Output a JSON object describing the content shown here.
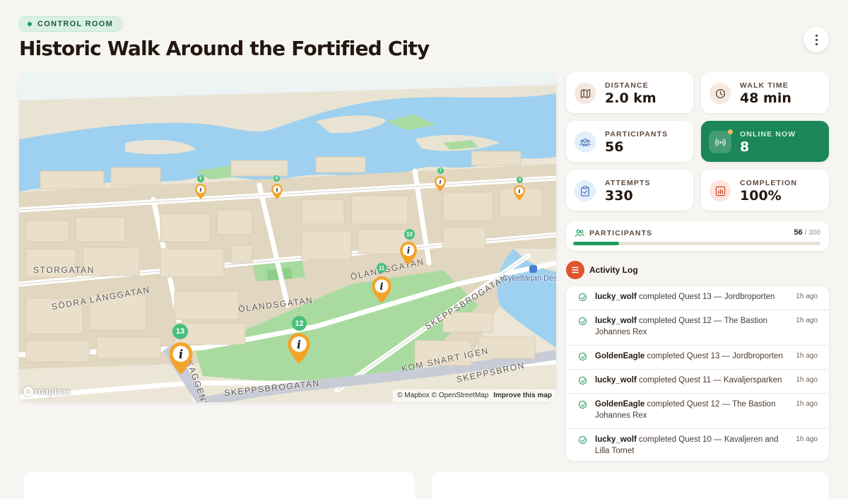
{
  "header": {
    "badge": "CONTROL ROOM",
    "title": "Historic Walk Around the Fortified City",
    "more_icon": "more-vertical-icon"
  },
  "map": {
    "street_labels": [
      "STORGATAN",
      "SÖDRA LÅNGGATAN",
      "ÖLANDSGATAN",
      "ÖLANDSGATAN",
      "SKEPPSBROGATAN",
      "KOM SNART IGEN",
      "SKEPPSBRON",
      "KAGGENSG",
      "SKEPPSBROGATAN"
    ],
    "poi_label": "Cykelfärjan Des",
    "pins": [
      {
        "num": "6"
      },
      {
        "num": "8"
      },
      {
        "num": "7"
      },
      {
        "num": "4"
      },
      {
        "num": "10"
      },
      {
        "num": "11"
      },
      {
        "num": "12"
      },
      {
        "num": "13"
      }
    ],
    "logo": "mapbox",
    "attribution": "© Mapbox © OpenStreetMap",
    "improve": "Improve this map",
    "colors": {
      "water": "#9ed1ef",
      "park": "#a9dba0",
      "building": "#e4d9c3",
      "pin": "#f4a32a",
      "badge": "#47c07c"
    }
  },
  "stats": [
    {
      "label": "DISTANCE",
      "value": "2.0 km",
      "icon": "map-icon",
      "color": "#f4e8df"
    },
    {
      "label": "WALK TIME",
      "value": "48 min",
      "icon": "clock-icon",
      "color": "#f4e8df"
    },
    {
      "label": "PARTICIPANTS",
      "value": "56",
      "icon": "users-icon",
      "color": "#e2eefb"
    },
    {
      "label": "ONLINE NOW",
      "value": "8",
      "icon": "broadcast-icon",
      "color": "#1b8658"
    },
    {
      "label": "ATTEMPTS",
      "value": "330",
      "icon": "clipboard-check-icon",
      "color": "#e2eefb"
    },
    {
      "label": "COMPLETION",
      "value": "100%",
      "icon": "bar-chart-icon",
      "color": "#fde4dc"
    }
  ],
  "participants_progress": {
    "label": "PARTICIPANTS",
    "count": "56",
    "total": "/ 300",
    "fraction": 0.187
  },
  "activity_log": {
    "title": "Activity Log",
    "items": [
      {
        "user": "lucky_wolf",
        "text": "completed Quest 13 — Jordbroporten",
        "time": "1h ago"
      },
      {
        "user": "lucky_wolf",
        "text": "completed Quest 12 — The Bastion Johannes Rex",
        "time": "1h ago"
      },
      {
        "user": "GoldenEagle",
        "text": "completed Quest 13 — Jordbroporten",
        "time": "1h ago"
      },
      {
        "user": "lucky_wolf",
        "text": "completed Quest 11 — Kavaljersparken",
        "time": "1h ago"
      },
      {
        "user": "GoldenEagle",
        "text": "completed Quest 12 — The Bastion Johannes Rex",
        "time": "1h ago"
      },
      {
        "user": "lucky_wolf",
        "text": "completed Quest 10 — Kavaljeren and Lilla Tornet",
        "time": "1h ago"
      }
    ]
  }
}
